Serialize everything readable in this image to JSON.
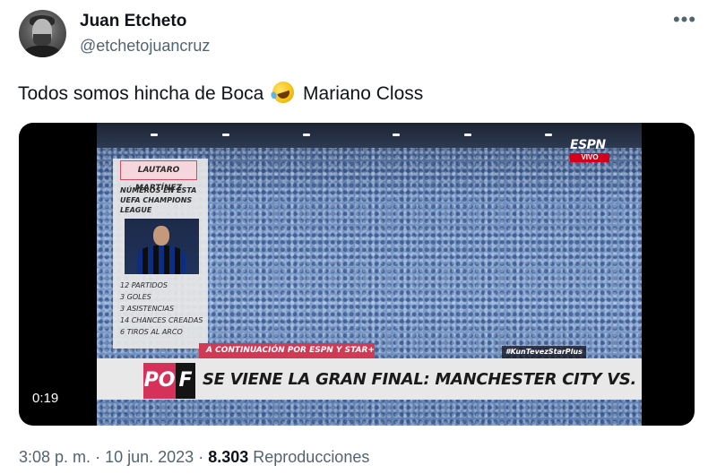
{
  "author": {
    "display_name": "Juan Etcheto",
    "handle": "@etchetojuancruz",
    "avatar_icon": "profile-photo"
  },
  "more_icon": "ellipsis-icon",
  "tweet": {
    "text_before_emoji": "Todos somos hincha de Boca",
    "emoji": "rolling-on-floor-laughing",
    "text_after_emoji": "Mariano Closs"
  },
  "video": {
    "duration": "0:19",
    "broadcaster": "ESPN",
    "live_label": "VIVO",
    "player_card": {
      "name": "LAUTARO MARTÍNEZ",
      "subtitle": "NÚMEROS EN ESTA UEFA CHAMPIONS LEAGUE",
      "stats": [
        "12 PARTIDOS",
        "3 GOLES",
        "3 ASISTENCIAS",
        "14 CHANCES CREADAS",
        "6 TIROS AL ARCO"
      ]
    },
    "next_label": "A CONTINUACIÓN POR ESPN Y STAR+",
    "hashtag": "#KunTevezStarPlus",
    "show_logo_p": "PO",
    "show_logo_f": "F",
    "headline": "SE VIENE LA GRAN FINAL: MANCHESTER CITY VS. INTER"
  },
  "meta": {
    "time": "3:08 p. m.",
    "separator": "·",
    "date": "10 jun. 2023",
    "views_count": "8.303",
    "views_label": "Reproducciones"
  },
  "colors": {
    "text_primary": "#0f1419",
    "text_secondary": "#536471",
    "espn_red": "#d5001c",
    "graphic_pink": "#d5315a"
  }
}
